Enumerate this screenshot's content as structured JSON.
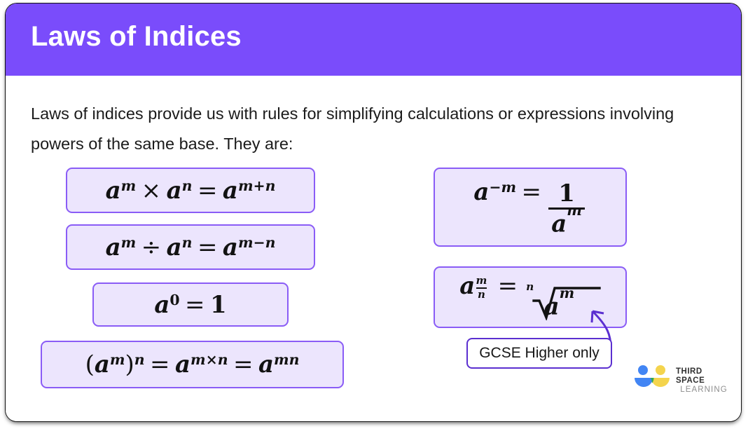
{
  "header": {
    "title": "Laws of Indices",
    "background_color": "#7a4cfb",
    "title_color": "#ffffff"
  },
  "body": {
    "intro_text": "Laws of indices provide us with rules for simplifying calculations or expressions involving powers of the same base. They are:"
  },
  "formulas": {
    "box_fill": "#ece5fd",
    "box_border": "#8a5cf6",
    "multiplication": {
      "label": "a^m x a^n = a^(m+n)",
      "base": "a",
      "exp1": "m",
      "operator": "×",
      "base2": "a",
      "exp2": "n",
      "equals": "=",
      "result_base": "a",
      "result_exp": "m+n"
    },
    "division": {
      "label": "a^m / a^n = a^(m-n)",
      "base": "a",
      "exp1": "m",
      "operator": "÷",
      "base2": "a",
      "exp2": "n",
      "equals": "=",
      "result_base": "a",
      "result_exp": "m−n"
    },
    "zero_index": {
      "label": "a^0 = 1",
      "base": "a",
      "exp": "0",
      "equals": "=",
      "result": "1"
    },
    "power_of_power": {
      "label": "(a^m)^n = a^(m x n) = a^(mn)",
      "open_paren": "(",
      "base": "a",
      "inner_exp": "m",
      "close_paren": ")",
      "outer_exp": "n",
      "equals1": "=",
      "mid_base": "a",
      "mid_exp": "m×n",
      "equals2": "=",
      "result_base": "a",
      "result_exp": "mn"
    },
    "negative_index": {
      "label": "a^-m = 1 / a^m",
      "base": "a",
      "exp": "−m",
      "equals": "=",
      "numerator": "1",
      "denominator_base": "a",
      "denominator_exp": "m"
    },
    "fractional_index": {
      "label": "a^(m/n) = nth root of a^m",
      "base": "a",
      "exp_numerator": "m",
      "exp_denominator": "n",
      "equals": "=",
      "root_index": "n",
      "radicand_base": "a",
      "radicand_exp": "m"
    }
  },
  "callout": {
    "text": "GCSE Higher only",
    "border_color": "#5b2fd0",
    "arrow_color": "#5b2fd0"
  },
  "logo": {
    "line1": "THIRD SPACE",
    "line2": "LEARNING",
    "blue": "#4285f4",
    "yellow": "#f4d44d",
    "green": "#34a853"
  }
}
